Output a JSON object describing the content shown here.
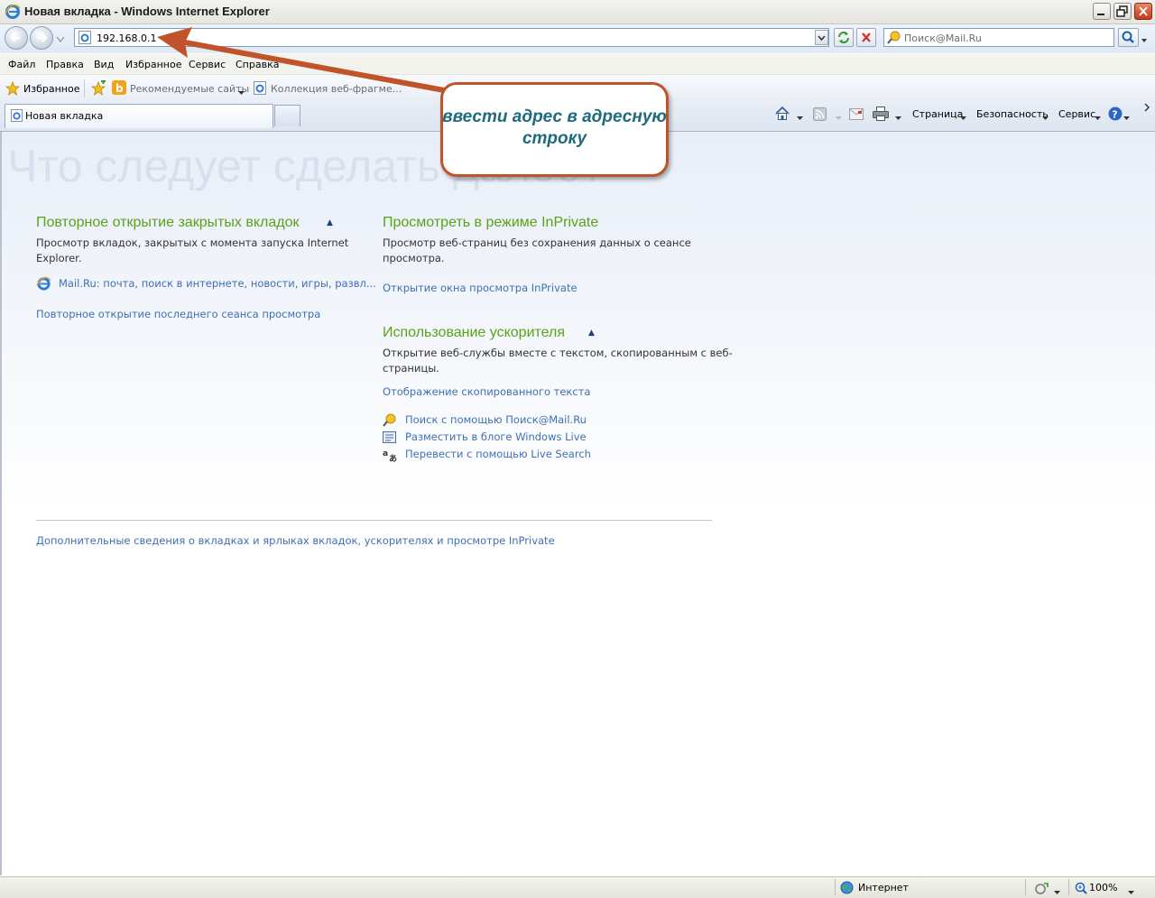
{
  "window": {
    "title": "Новая вкладка - Windows Internet Explorer"
  },
  "navigation": {
    "address": "192.168.0.1",
    "search_placeholder": "Поиск@Mail.Ru"
  },
  "menu": [
    "Файл",
    "Правка",
    "Вид",
    "Избранное",
    "Сервис",
    "Справка"
  ],
  "favorites_bar": {
    "favorites_label": "Избранное",
    "items": [
      "Рекомендуемые сайты",
      "Коллекция веб-фрагме..."
    ]
  },
  "tabs": {
    "active_tab": "Новая вкладка"
  },
  "command_bar": {
    "page": "Страница",
    "safety": "Безопасность",
    "tools": "Сервис"
  },
  "content": {
    "heading": "Что следует сделать далее?",
    "reopen": {
      "title": "Повторное открытие закрытых вкладок",
      "description": "Просмотр вкладок, закрытых с момента запуска Internet Explorer.",
      "closed_item": "Mail.Ru: почта, поиск в интернете, новости, игры, развл...",
      "reopen_session": "Повторное открытие последнего сеанса просмотра"
    },
    "inprivate": {
      "title": "Просмотреть в режиме InPrivate",
      "description": "Просмотр веб-страниц без сохранения данных о сеансе просмотра.",
      "link": "Открытие окна просмотра InPrivate"
    },
    "accelerators": {
      "title": "Использование ускорителя",
      "description": "Открытие веб-службы вместе с текстом, скопированным с веб-страницы.",
      "show_copied": "Отображение скопированного текста",
      "items": [
        "Поиск с помощью Поиск@Mail.Ru",
        "Разместить в блоге Windows Live",
        "Перевести с помощью Live Search"
      ]
    },
    "more_info": "Дополнительные сведения о вкладках и ярлыках вкладок, ускорителях и просмотре InPrivate"
  },
  "status_bar": {
    "zone": "Интернет",
    "zoom": "100%"
  },
  "callout": {
    "text": "ввести адрес в адресную строку"
  },
  "colors": {
    "section_title": "#5aa318",
    "link": "#3f70b4",
    "arrow": "#c0532a",
    "callout_text": "#1d6b7c"
  }
}
